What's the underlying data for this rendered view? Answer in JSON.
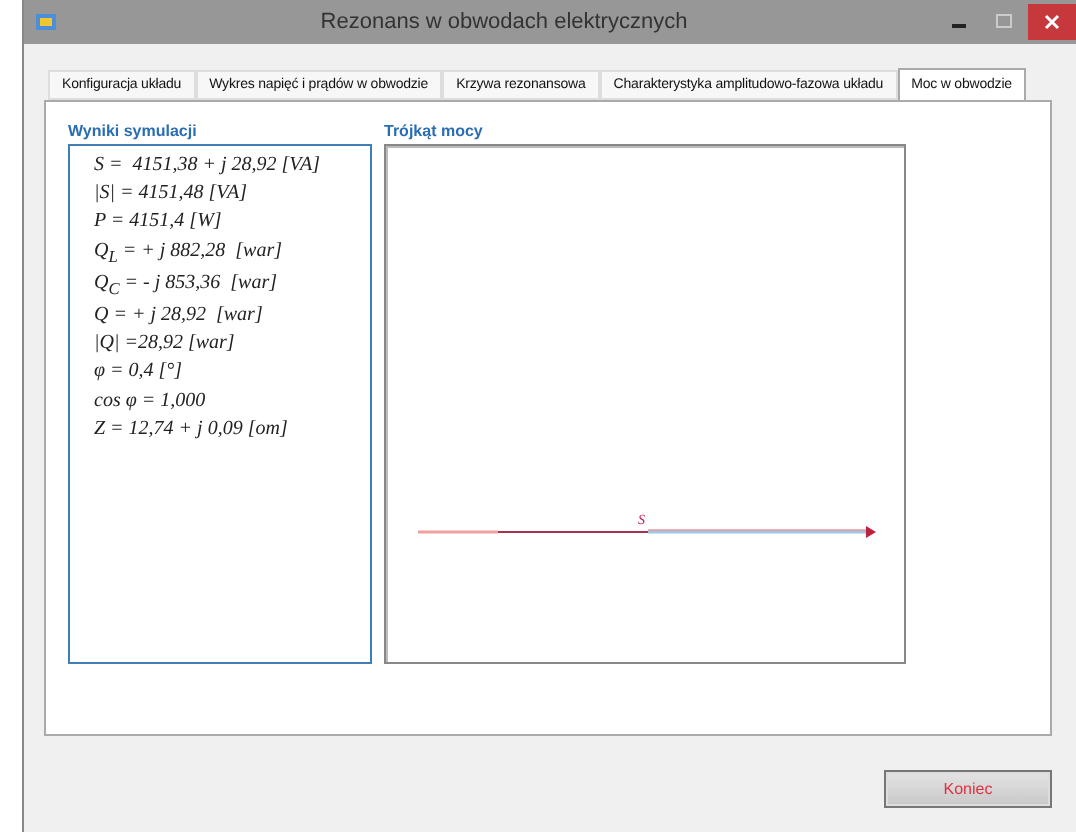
{
  "window": {
    "title": "Rezonans w obwodach elektrycznych"
  },
  "tabs": [
    {
      "label": "Konfiguracja układu",
      "selected": false
    },
    {
      "label": "Wykres napięć i prądów w obwodzie",
      "selected": false
    },
    {
      "label": "Krzywa rezonansowa",
      "selected": false
    },
    {
      "label": "Charakterystyka amplitudowo-fazowa układu",
      "selected": false
    },
    {
      "label": "Moc w obwodzie",
      "selected": true
    }
  ],
  "results": {
    "title": "Wyniki symulacji",
    "lines": [
      "S =  4151,38 + j 28,92 [VA]",
      "|S| = 4151,48 [VA]",
      "P = 4151,4 [W]",
      "Q$_{L}$ = + j 882,28  [war]",
      "Q$_{C}$ = - j 853,36  [war]",
      "Q = + j 28,92  [war]",
      "|Q| =28,92 [war]",
      "φ = 0,4 [°]",
      "cos φ = 1,000",
      "Z = 12,74 + j 0,09 [om]"
    ]
  },
  "triangle": {
    "title": "Trójkąt mocy",
    "vector_label": "S"
  },
  "buttons": [
    {
      "label": "Koniec"
    }
  ]
}
